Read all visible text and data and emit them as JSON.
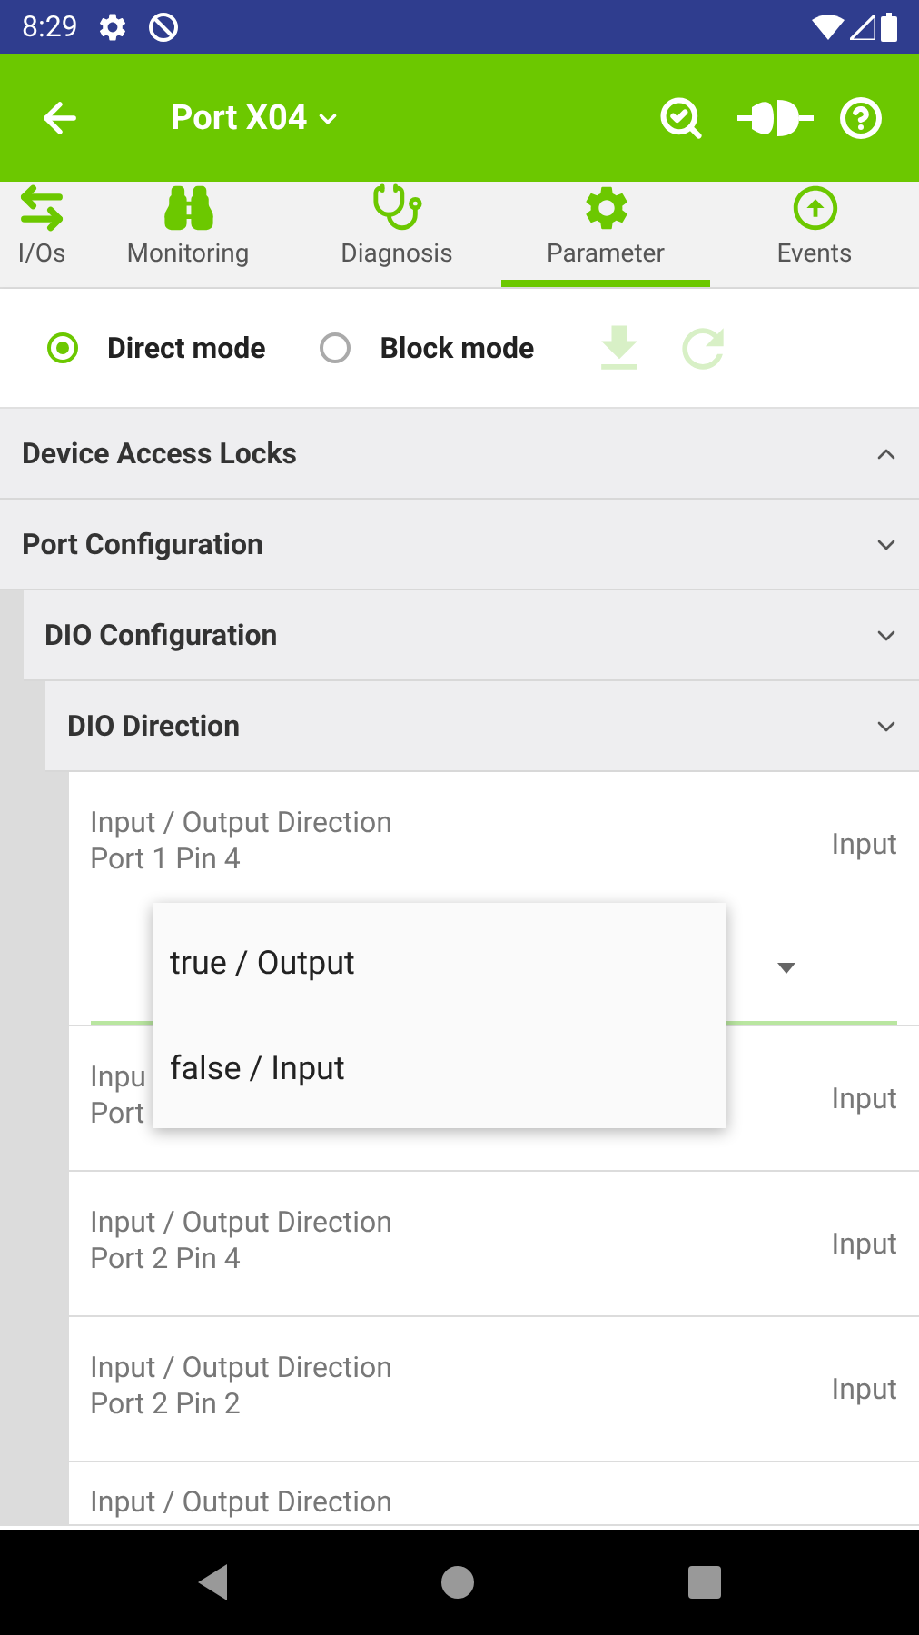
{
  "status_bar": {
    "time": "8:29"
  },
  "app_bar": {
    "title": "Port X04"
  },
  "tabs": [
    {
      "label": "I/Os",
      "kind": "io",
      "selected": false
    },
    {
      "label": "Monitoring",
      "kind": "monitoring",
      "selected": false
    },
    {
      "label": "Diagnosis",
      "kind": "diagnosis",
      "selected": false
    },
    {
      "label": "Parameter",
      "kind": "parameter",
      "selected": true
    },
    {
      "label": "Events",
      "kind": "events",
      "selected": false
    }
  ],
  "modes": [
    {
      "label": "Direct mode",
      "selected": true
    },
    {
      "label": "Block mode",
      "selected": false
    }
  ],
  "toolbar": [
    {
      "kind": "download",
      "disabled": true
    },
    {
      "kind": "reset",
      "disabled": true
    }
  ],
  "sections": [
    {
      "title": "Device Access Locks",
      "expanded": true
    },
    {
      "title": "Port Configuration",
      "expanded": false,
      "children": [
        {
          "title": "DIO Configuration",
          "expanded": false,
          "children": [
            {
              "title": "DIO Direction",
              "expanded": false,
              "parameters": [
                {
                  "name": "Input / Output Direction",
                  "port": "Port 1 Pin 4",
                  "value": "Input",
                  "dropdown": {
                    "options": [
                      {
                        "label": "true / Output"
                      },
                      {
                        "label": "false / Input"
                      }
                    ]
                  }
                },
                {
                  "name": "Inpu",
                  "port": "Port",
                  "value": "Input"
                },
                {
                  "name": "Input / Output Direction",
                  "port": "Port 2 Pin 4",
                  "value": "Input"
                },
                {
                  "name": "Input / Output Direction",
                  "port": "Port 2 Pin 2",
                  "value": "Input"
                },
                {
                  "name": "Input / Output Direction"
                }
              ]
            }
          ]
        }
      ]
    }
  ]
}
